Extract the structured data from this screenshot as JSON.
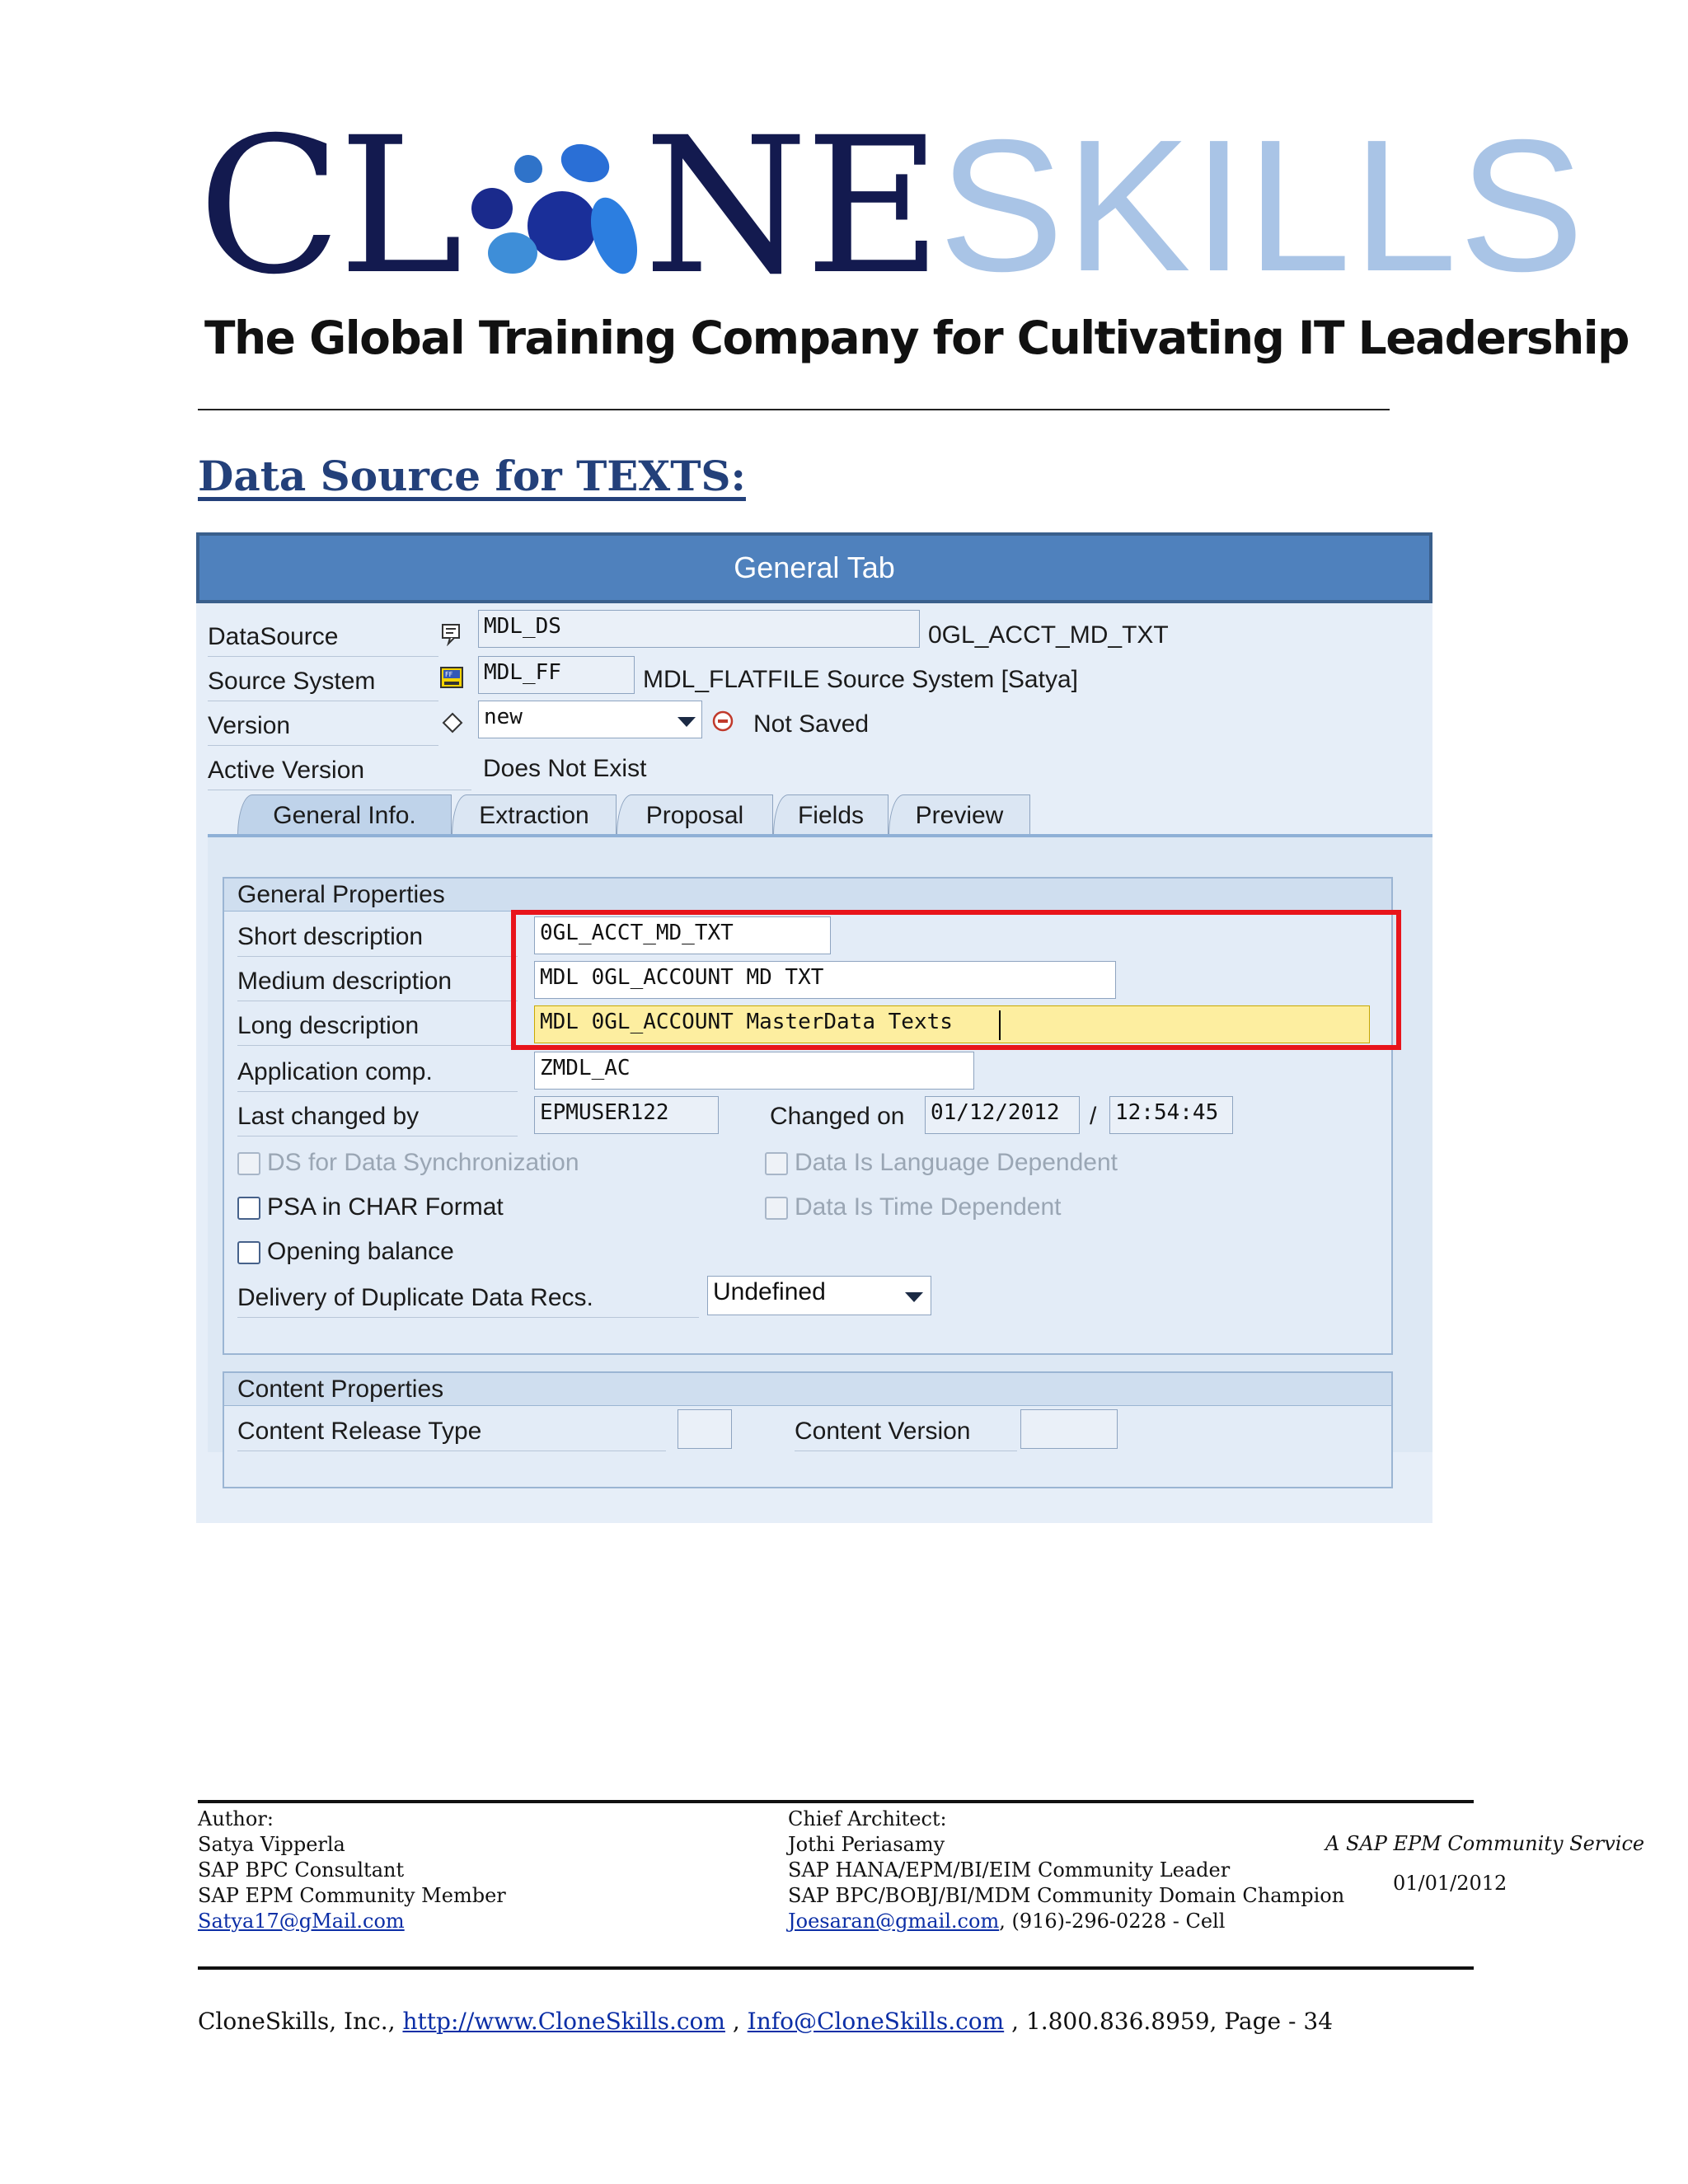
{
  "logo": {
    "brand_dark": "CL",
    "brand_dark_2": "NE",
    "brand_light": "SKILLS",
    "tagline": "The Global Training Company for Cultivating IT Leadership"
  },
  "heading": "Data Source for TEXTS:",
  "window": {
    "title": "General Tab",
    "datasource": {
      "label": "DataSource",
      "value": "MDL_DS",
      "desc": "0GL_ACCT_MD_TXT",
      "icon": "datasource-icon"
    },
    "source_system": {
      "label": "Source System",
      "value": "MDL_FF",
      "desc": "MDL_FLATFILE Source System [Satya]",
      "icon": "flatfile-system-icon"
    },
    "version": {
      "label": "Version",
      "value": "new",
      "status": "Not Saved",
      "icon": "diamond-icon",
      "status_icon": "minus-circle-icon"
    },
    "active_version": {
      "label": "Active Version",
      "value": "Does Not Exist"
    },
    "tabs": [
      {
        "label": "General Info.",
        "active": true
      },
      {
        "label": "Extraction",
        "active": false
      },
      {
        "label": "Proposal",
        "active": false
      },
      {
        "label": "Fields",
        "active": false
      },
      {
        "label": "Preview",
        "active": false
      }
    ],
    "general_properties": {
      "title": "General Properties",
      "short_desc": {
        "label": "Short description",
        "value": "0GL_ACCT_MD_TXT"
      },
      "medium_desc": {
        "label": "Medium description",
        "value": "MDL 0GL_ACCOUNT MD TXT"
      },
      "long_desc": {
        "label": "Long description",
        "value": "MDL 0GL_ACCOUNT MasterData Texts"
      },
      "app_comp": {
        "label": "Application comp.",
        "value": "ZMDL_AC"
      },
      "last_changed_by": {
        "label": "Last changed by",
        "value": "EPMUSER122"
      },
      "changed_on": {
        "label": "Changed on",
        "date": "01/12/2012",
        "sep": "/",
        "time": "12:54:45"
      },
      "checkboxes": {
        "ds_sync": {
          "label": "DS for Data Synchronization",
          "checked": false,
          "disabled": true
        },
        "lang_dep": {
          "label": "Data Is Language Dependent",
          "checked": false,
          "disabled": true
        },
        "psa_char": {
          "label": "PSA in CHAR Format",
          "checked": false,
          "disabled": false
        },
        "time_dep": {
          "label": "Data Is Time Dependent",
          "checked": false,
          "disabled": true
        },
        "opening_balance": {
          "label": "Opening balance",
          "checked": false,
          "disabled": false
        }
      },
      "delivery": {
        "label": "Delivery of Duplicate Data Recs.",
        "value": "Undefined"
      }
    },
    "content_properties": {
      "title": "Content Properties",
      "release_type": {
        "label": "Content Release Type",
        "value": ""
      },
      "version": {
        "label": "Content Version",
        "value": ""
      }
    }
  },
  "footer": {
    "author": {
      "label": "Author:",
      "name": "Satya Vipperla",
      "role1": "SAP BPC Consultant",
      "role2": "SAP EPM Community Member",
      "email": "Satya17@gMail.com"
    },
    "architect": {
      "label": "Chief Architect:",
      "name": "Jothi Periasamy",
      "role1": "SAP HANA/EPM/BI/EIM Community Leader",
      "role2": "SAP BPC/BOBJ/BI/MDM Community Domain Champion",
      "email": "Joesaran@gmail.com",
      "phone": ", (916)-296-0228 - Cell"
    },
    "service": "A SAP EPM Community Service",
    "date": "01/01/2012",
    "company": "CloneSkills, Inc., ",
    "url": "http://www.CloneSkills.com",
    "sep1": " , ",
    "info_email": "Info@CloneSkills.com",
    "tail": " , 1.800.836.8959, Page - 34"
  },
  "colors": {
    "sap_title": "#4f81bd",
    "highlight_red": "#e8141b",
    "link": "#0b2ea6",
    "heading": "#23407a"
  }
}
